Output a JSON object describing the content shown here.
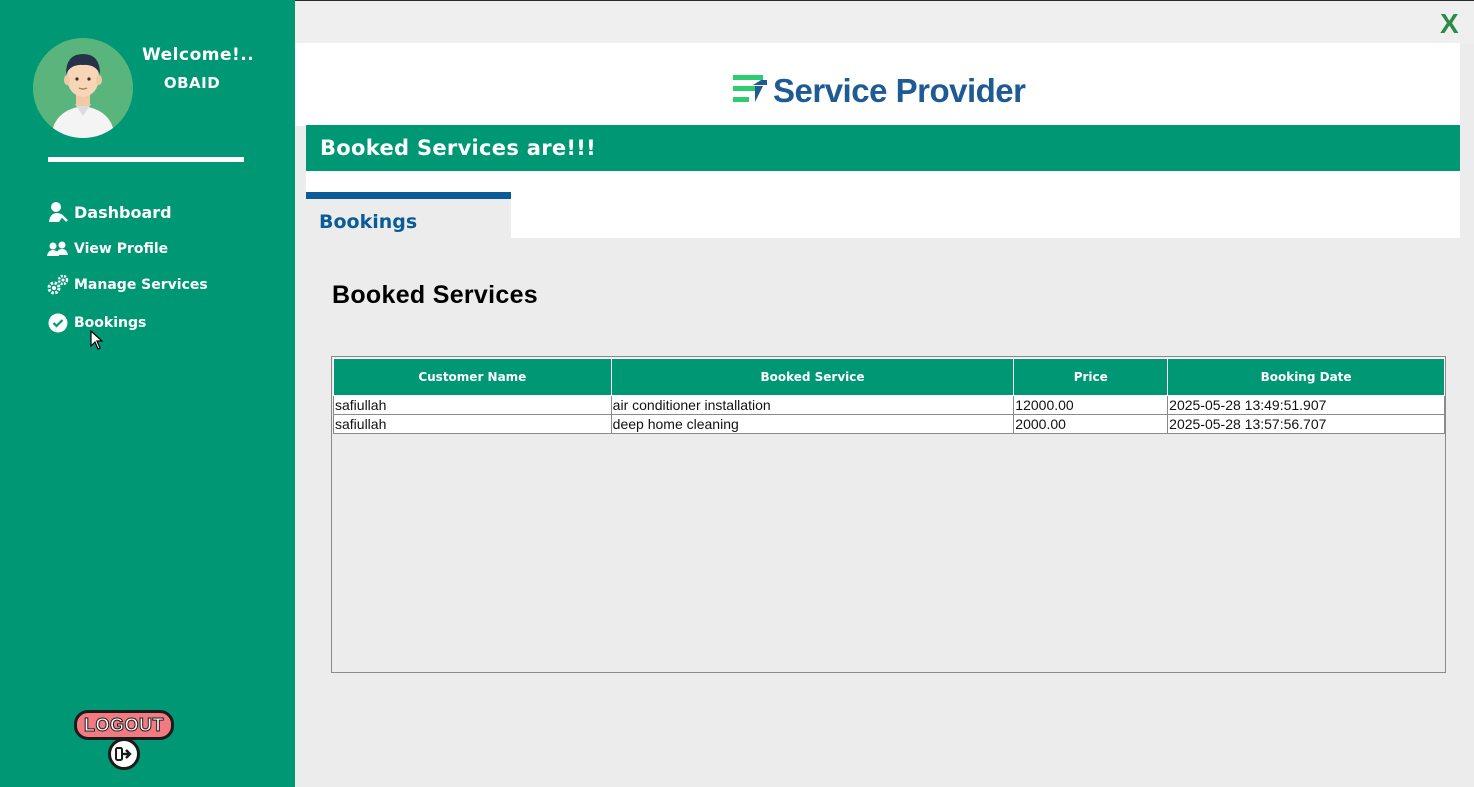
{
  "sidebar": {
    "welcome": "Welcome!..",
    "username": "OBAID",
    "nav": [
      {
        "label": "Dashboard",
        "icon": "user-icon"
      },
      {
        "label": "View Profile",
        "icon": "users-icon"
      },
      {
        "label": "Manage Services",
        "icon": "gears-icon"
      },
      {
        "label": "Bookings",
        "icon": "check-circle-icon"
      }
    ],
    "logout_label": "LOGOUT"
  },
  "window": {
    "close_label": "X"
  },
  "header": {
    "brand_name": "Service Provider",
    "banner": "Booked Services are!!!"
  },
  "tabs": [
    {
      "label": "Bookings"
    }
  ],
  "main": {
    "title": "Booked Services",
    "table": {
      "columns": [
        "Customer Name",
        "Booked Service",
        "Price",
        "Booking Date"
      ],
      "rows": [
        [
          "safiullah",
          "air conditioner installation",
          "12000.00",
          "2025-05-28 13:49:51.907"
        ],
        [
          "safiullah",
          "deep home cleaning",
          "2000.00",
          "2025-05-28 13:57:56.707"
        ]
      ]
    }
  },
  "colors": {
    "sidebar_bg": "#009774",
    "accent_blue": "#0a5b96",
    "brand_blue": "#1e5a93",
    "brand_green": "#2ecc71",
    "close_green": "#2e8b46",
    "logout_red": "#f27a82"
  }
}
